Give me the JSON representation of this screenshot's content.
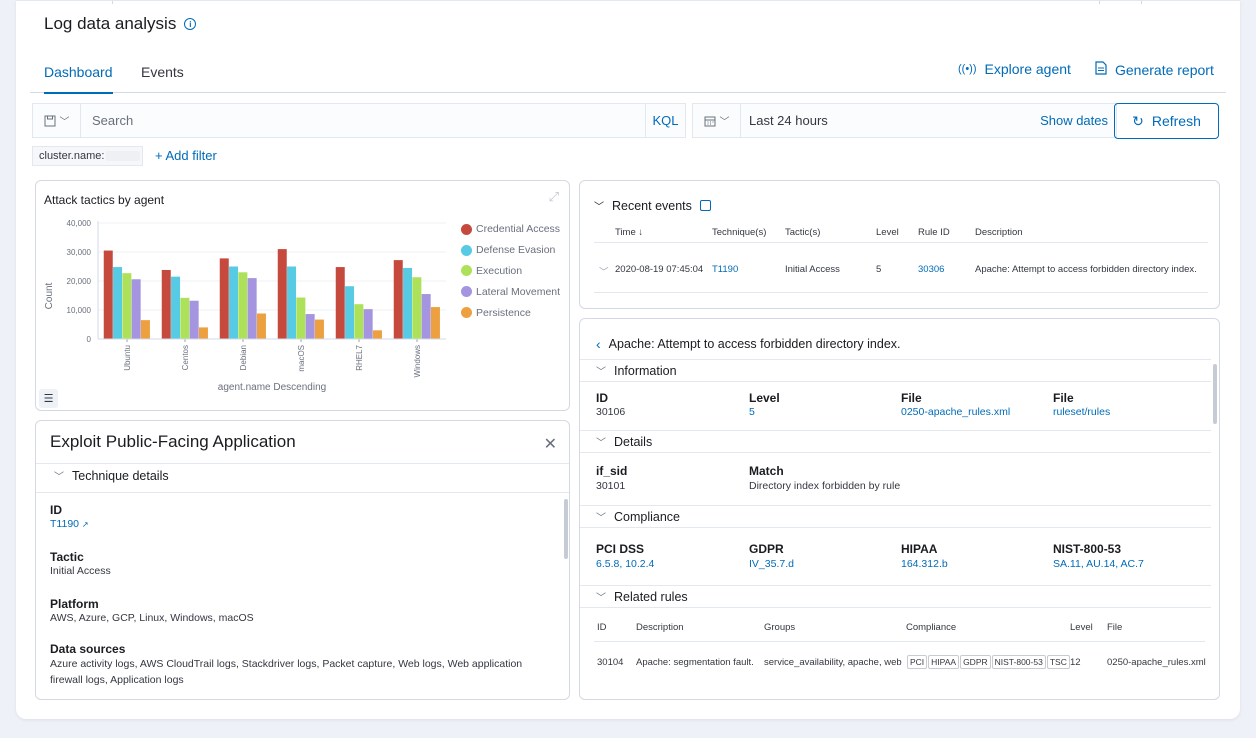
{
  "header": {
    "title": "Log data analysis",
    "tabs": [
      {
        "label": "Dashboard"
      },
      {
        "label": "Events"
      }
    ],
    "explore_agent": "Explore agent",
    "generate_report": "Generate report"
  },
  "search": {
    "placeholder": "Search",
    "language": "KQL"
  },
  "date": {
    "range": "Last 24 hours",
    "show_dates": "Show dates"
  },
  "refresh_label": "Refresh",
  "filters": {
    "pill_label": "cluster.name:",
    "add_label": "+ Add filter"
  },
  "attack_panel": {
    "title": "Attack tactics by agent"
  },
  "chart_data": {
    "type": "bar",
    "title": "Attack tactics by agent",
    "xlabel": "agent.name Descending",
    "ylabel": "Count",
    "ylim": [
      0,
      40000
    ],
    "yticks": [
      "0",
      "10,000",
      "20,000",
      "30,000",
      "40,000"
    ],
    "categories": [
      "Ubuntu",
      "Centos",
      "Debian",
      "macOS",
      "RHEL7",
      "Windows"
    ],
    "legend_position": "right",
    "series": [
      {
        "name": "Credential Access",
        "color": "#c6493e",
        "values": [
          30500,
          23800,
          27800,
          31000,
          24800,
          27200
        ]
      },
      {
        "name": "Defense Evasion",
        "color": "#56cbe3",
        "values": [
          24800,
          21500,
          25000,
          25000,
          18200,
          24500
        ]
      },
      {
        "name": "Execution",
        "color": "#aee15a",
        "values": [
          22700,
          14200,
          23000,
          14300,
          12000,
          21300
        ]
      },
      {
        "name": "Lateral Movement",
        "color": "#a594df",
        "values": [
          20600,
          13200,
          21000,
          8600,
          10300,
          15500
        ]
      },
      {
        "name": "Persistence",
        "color": "#eda040",
        "values": [
          6500,
          4000,
          8800,
          6700,
          3000,
          11000
        ]
      }
    ]
  },
  "exploit": {
    "title": "Exploit Public-Facing Application",
    "section": "Technique details",
    "fields": [
      {
        "label": "ID",
        "value": "T1190"
      },
      {
        "label": "Tactic",
        "value": "Initial Access"
      },
      {
        "label": "Platform",
        "value": "AWS, Azure, GCP, Linux, Windows, macOS"
      },
      {
        "label": "Data sources",
        "value": "Azure activity logs, AWS CloudTrail logs, Stackdriver logs, Packet capture, Web logs, Web application firewall logs, Application logs"
      }
    ]
  },
  "recent_events": {
    "title": "Recent events",
    "columns": [
      "Time ↓",
      "Technique(s)",
      "Tactic(s)",
      "Level",
      "Rule ID",
      "Description"
    ],
    "rows": [
      {
        "time": "2020-08-19 07:45:04",
        "technique": "T1190",
        "tactic": "Initial Access",
        "level": "5",
        "rule_id": "30306",
        "description": "Apache: Attempt to access forbidden directory index."
      }
    ]
  },
  "rule_detail": {
    "title": "Apache: Attempt to access forbidden directory index.",
    "information": {
      "header": "Information",
      "items": [
        {
          "label": "ID",
          "value": "30106"
        },
        {
          "label": "Level",
          "value": "5"
        },
        {
          "label": "File",
          "value": "0250-apache_rules.xml"
        },
        {
          "label": "File",
          "value": "ruleset/rules"
        }
      ]
    },
    "details": {
      "header": "Details",
      "items": [
        {
          "label": "if_sid",
          "value": "30101"
        },
        {
          "label": "Match",
          "value": "Directory index forbidden by rule"
        }
      ]
    },
    "compliance": {
      "header": "Compliance",
      "items": [
        {
          "label": "PCI DSS",
          "value": "6.5.8, 10.2.4"
        },
        {
          "label": "GDPR",
          "value": "IV_35.7.d"
        },
        {
          "label": "HIPAA",
          "value": "164.312.b"
        },
        {
          "label": "NIST-800-53",
          "value": "SA.11, AU.14, AC.7"
        }
      ]
    },
    "related": {
      "header": "Related rules",
      "columns": [
        "ID",
        "Description",
        "Groups",
        "Compliance",
        "Level",
        "File"
      ],
      "row": {
        "id": "30104",
        "description": "Apache: segmentation fault.",
        "groups": "service_availability, apache, web",
        "badges": [
          "PCI",
          "HIPAA",
          "GDPR",
          "NIST-800-53",
          "TSC"
        ],
        "level": "12",
        "file": "0250-apache_rules.xml"
      }
    }
  }
}
